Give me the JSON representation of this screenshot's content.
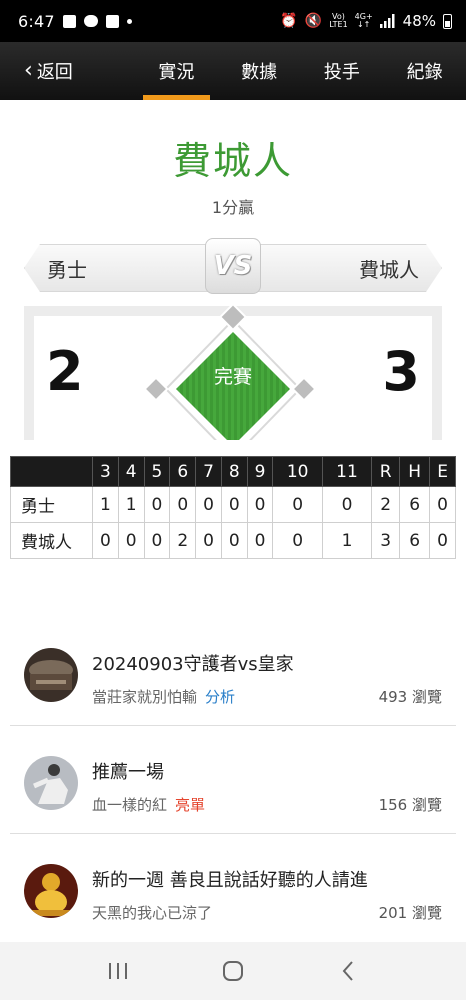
{
  "status_bar": {
    "time": "6:47",
    "signal_label_top": "Vo)",
    "signal_label_bottom": "LTE1",
    "network_top": "4G+",
    "battery": "48%"
  },
  "nav": {
    "back_label": "返回",
    "tabs": [
      {
        "label": "實況",
        "active": true
      },
      {
        "label": "數據",
        "active": false
      },
      {
        "label": "投手",
        "active": false
      },
      {
        "label": "紀錄",
        "active": false
      }
    ]
  },
  "game": {
    "winner": "費城人",
    "margin": "1分贏",
    "away_team": "勇士",
    "home_team": "費城人",
    "vs": "VS",
    "away_score": "2",
    "home_score": "3",
    "status": "完賽",
    "colors": {
      "field": "#43a73a",
      "winner_text": "#3d9a34",
      "active_tab": "#f19a1b"
    }
  },
  "linescore": {
    "headers": [
      "",
      "3",
      "4",
      "5",
      "6",
      "7",
      "8",
      "9",
      "10",
      "11",
      "R",
      "H",
      "E"
    ],
    "rows": [
      [
        "勇士",
        "1",
        "1",
        "0",
        "0",
        "0",
        "0",
        "0",
        "0",
        "0",
        "2",
        "6",
        "0"
      ],
      [
        "費城人",
        "0",
        "0",
        "0",
        "2",
        "0",
        "0",
        "0",
        "0",
        "1",
        "3",
        "6",
        "0"
      ]
    ]
  },
  "articles": [
    {
      "title": "20240903守護者vs皇家",
      "author": "當莊家就別怕輸",
      "tag": "分析",
      "tag_color": "#2a7fc9",
      "views": "493 瀏覽",
      "avatar": "avatar-dark-arena"
    },
    {
      "title": "推薦一場",
      "author": "血一樣的紅",
      "tag": "亮單",
      "tag_color": "#e5452e",
      "views": "156 瀏覽",
      "avatar": "avatar-pitcher"
    },
    {
      "title": "新的一週 善良且說話好聽的人請進",
      "author": "天黑的我心已涼了",
      "tag": "",
      "tag_color": "",
      "views": "201 瀏覽",
      "avatar": "avatar-golden-statue"
    }
  ],
  "system_nav": {
    "recents": "recents-icon",
    "home": "home-icon",
    "back": "back-icon"
  }
}
